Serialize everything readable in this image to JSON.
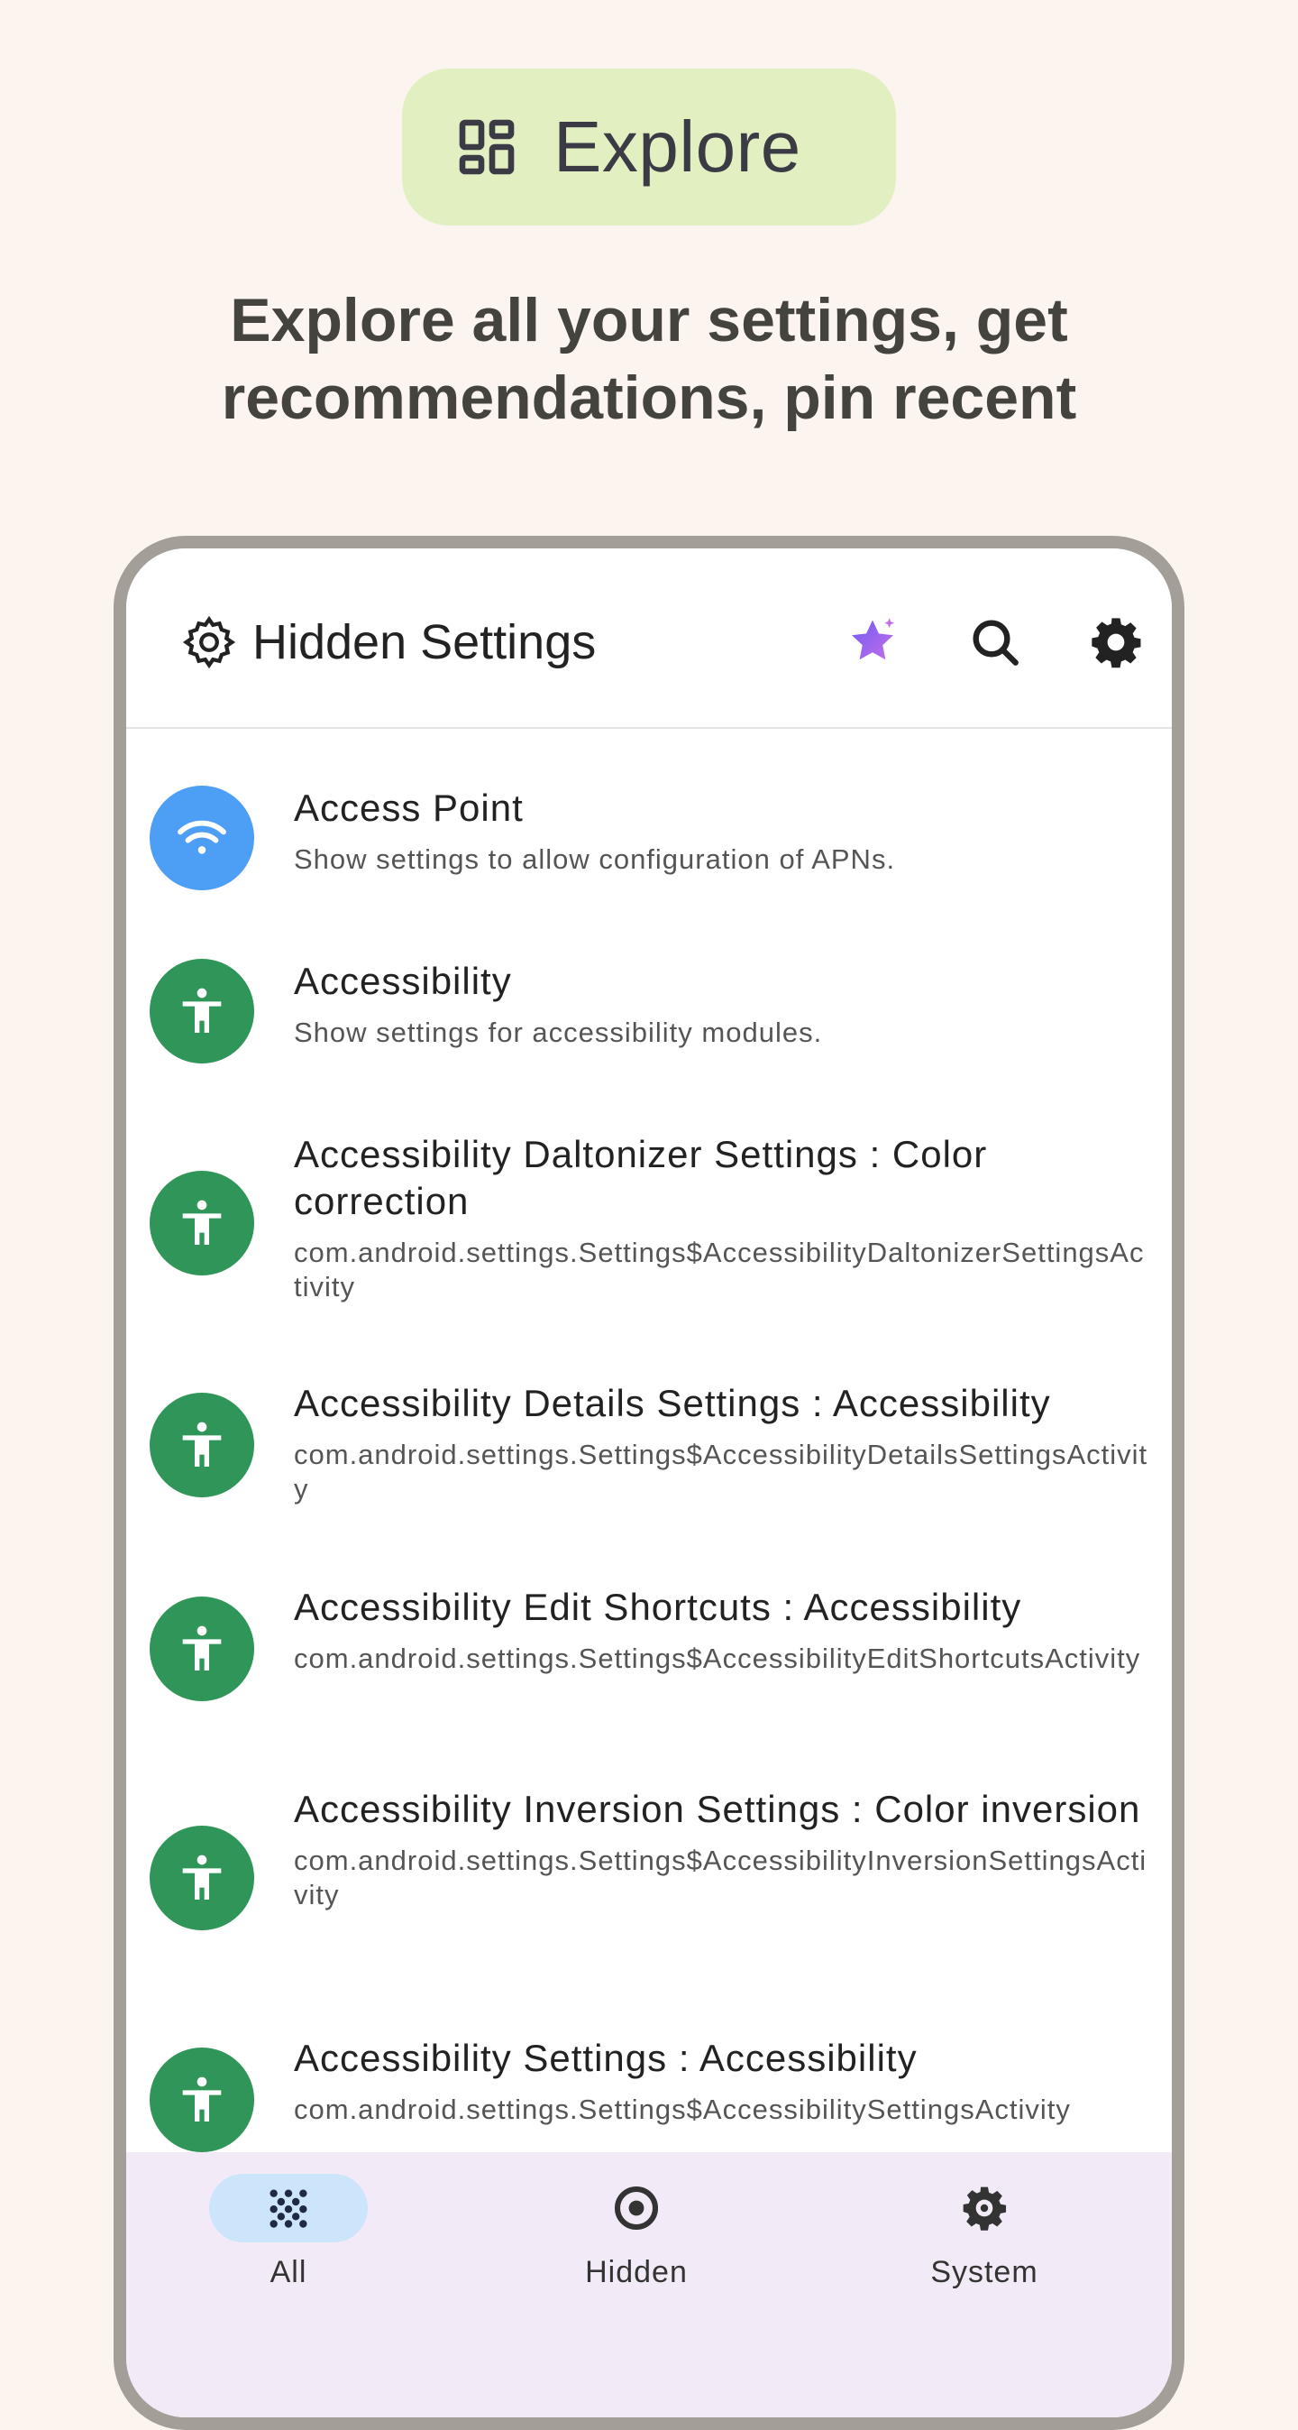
{
  "header": {
    "pill_label": "Explore",
    "subtitle_line1": "Explore all your settings, get",
    "subtitle_line2": "recommendations, pin recent"
  },
  "app": {
    "title": "Hidden Settings",
    "actions": [
      "premium-star-icon",
      "search-icon",
      "settings-gear-icon"
    ]
  },
  "list_items": [
    {
      "title": "Access Point",
      "subtitle": "Show settings to allow configuration of APNs.",
      "icon": "wifi-icon",
      "color": "#4d9ef5"
    },
    {
      "title": "Accessibility",
      "subtitle": "Show settings for accessibility modules.",
      "icon": "accessibility-icon",
      "color": "#2f9558"
    },
    {
      "title": "Accessibility Daltonizer Settings : Color correction",
      "subtitle": "com.android.settings.Settings$AccessibilityDaltonizerSettingsActivity",
      "icon": "accessibility-icon",
      "color": "#2f9558"
    },
    {
      "title": "Accessibility Details Settings : Accessibility",
      "subtitle": "com.android.settings.Settings$AccessibilityDetailsSettingsActivity",
      "icon": "accessibility-icon",
      "color": "#2f9558"
    },
    {
      "title": "Accessibility Edit Shortcuts : Accessibility",
      "subtitle": "com.android.settings.Settings$AccessibilityEditShortcutsActivity",
      "icon": "accessibility-icon",
      "color": "#2f9558"
    },
    {
      "title": "Accessibility Inversion Settings : Color inversion",
      "subtitle": "com.android.settings.Settings$AccessibilityInversionSettingsActivity",
      "icon": "accessibility-icon",
      "color": "#2f9558"
    },
    {
      "title": "Accessibility Settings : Accessibility",
      "subtitle": "com.android.settings.Settings$AccessibilitySettingsActivity",
      "icon": "accessibility-icon",
      "color": "#2f9558"
    }
  ],
  "nav": [
    {
      "label": "All",
      "icon": "dots-grid-icon",
      "selected": true
    },
    {
      "label": "Hidden",
      "icon": "hidden-circle-icon",
      "selected": false
    },
    {
      "label": "System",
      "icon": "system-gear-icon",
      "selected": false
    }
  ],
  "colors": {
    "background": "#fcf4ef",
    "pill": "#e1efc1",
    "nav_bg": "#f2eaf6",
    "nav_selected": "#cde5fb"
  }
}
